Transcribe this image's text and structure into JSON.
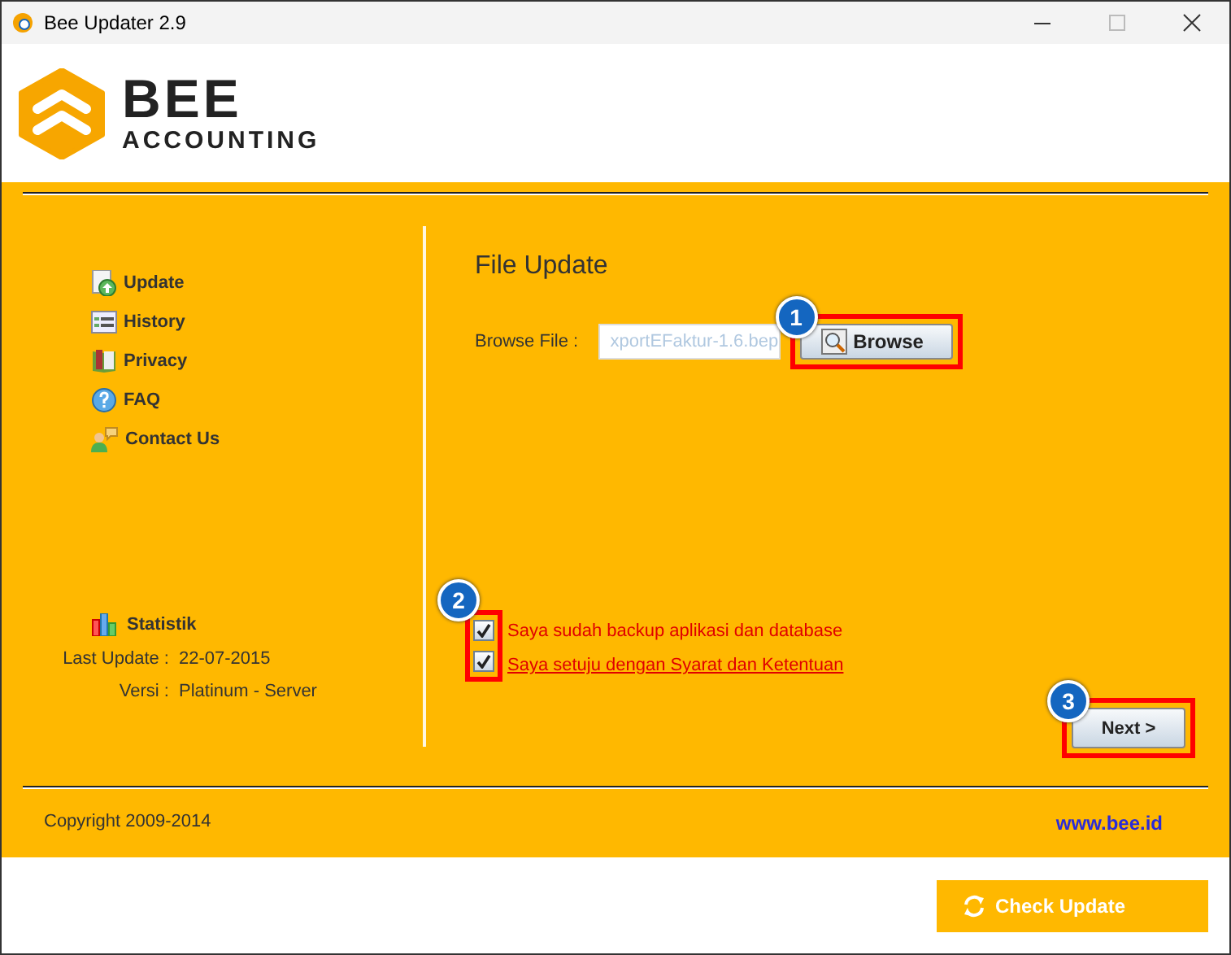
{
  "window": {
    "title": "Bee Updater 2.9"
  },
  "logo": {
    "name": "BEE",
    "tagline": "ACCOUNTING"
  },
  "menu": [
    {
      "label": "Update",
      "kind": "update"
    },
    {
      "label": "History",
      "kind": "history"
    },
    {
      "label": "Privacy",
      "kind": "privacy"
    },
    {
      "label": "FAQ",
      "kind": "faq"
    },
    {
      "label": "Contact Us",
      "kind": "contact"
    }
  ],
  "stats": {
    "title": "Statistik",
    "rows": [
      {
        "label": "Last Update :",
        "value": "22-07-2015"
      },
      {
        "label": "Versi :",
        "value": "Platinum - Server"
      }
    ]
  },
  "file_update": {
    "title": "File Update",
    "browse_label": "Browse File :",
    "file_value": "xportEFaktur-1.6.bep",
    "browse_button": "Browse",
    "step": "1"
  },
  "agreements": {
    "step": "2",
    "items": [
      {
        "kind": "text",
        "label": "Saya sudah backup aplikasi dan database",
        "checked": true
      },
      {
        "kind": "link",
        "label": "Saya setuju dengan Syarat dan Ketentuan",
        "checked": true
      }
    ]
  },
  "next": {
    "label": "Next >",
    "step": "3"
  },
  "footer": {
    "copyright": "Copyright 2009-2014",
    "website": "www.bee.id"
  },
  "check_update_button": "Check Update"
}
